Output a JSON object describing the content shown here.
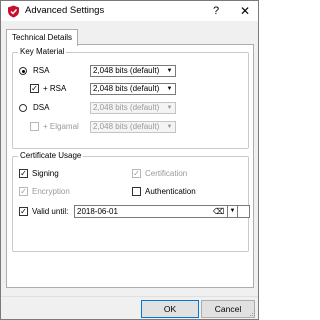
{
  "window": {
    "title": "Advanced Settings",
    "help": "?",
    "close": "✕"
  },
  "tabs": [
    {
      "label": "Technical Details"
    }
  ],
  "key_material": {
    "title": "Key Material",
    "rsa": {
      "label": "RSA",
      "selected": true,
      "value": "2,048 bits (default)"
    },
    "plus_rsa": {
      "label": "+ RSA",
      "checked": true,
      "value": "2,048 bits (default)"
    },
    "dsa": {
      "label": "DSA",
      "selected": false,
      "value": "2,048 bits (default)"
    },
    "plus_elgamal": {
      "label": "+ Elgamal",
      "checked": false,
      "value": "2,048 bits (default)"
    }
  },
  "certificate_usage": {
    "title": "Certificate Usage",
    "signing": {
      "label": "Signing",
      "checked": true
    },
    "certification": {
      "label": "Certification",
      "checked": true
    },
    "encryption": {
      "label": "Encryption",
      "checked": true
    },
    "authentication": {
      "label": "Authentication",
      "checked": false
    },
    "valid_until": {
      "label": "Valid until:",
      "checked": true,
      "value": "2018-06-01"
    }
  },
  "buttons": {
    "ok": "OK",
    "cancel": "Cancel"
  },
  "glyphs": {
    "check": "✓",
    "arrow": "▼",
    "clear": "⌫"
  }
}
